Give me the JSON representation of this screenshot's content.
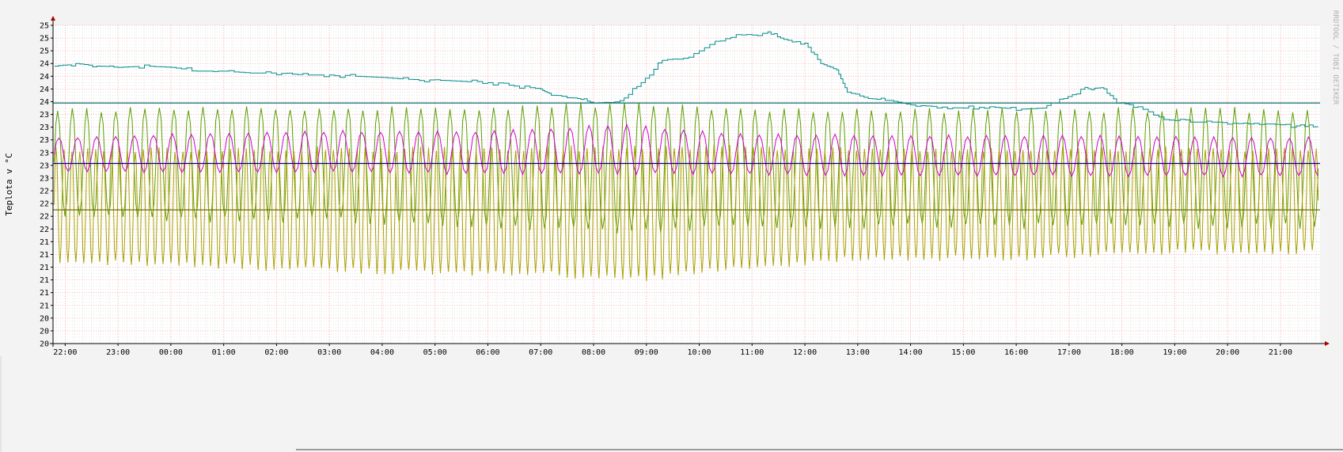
{
  "chart_data": {
    "type": "line",
    "ylabel": "Teplota v °C",
    "watermark": "RRDTOOL / TOBI OETIKER",
    "y_tick_labels": [
      "25",
      "25",
      "25",
      "24",
      "24",
      "24",
      "24",
      "23",
      "23",
      "23",
      "23",
      "23",
      "23",
      "22",
      "22",
      "22",
      "22",
      "21",
      "21",
      "21",
      "21",
      "21",
      "21",
      "20",
      "20",
      "20"
    ],
    "ylim": [
      20.0,
      25.0
    ],
    "x_tick_labels": [
      "22:00",
      "23:00",
      "00:00",
      "01:00",
      "02:00",
      "03:00",
      "04:00",
      "05:00",
      "06:00",
      "07:00",
      "08:00",
      "09:00",
      "10:00",
      "11:00",
      "12:00",
      "13:00",
      "14:00",
      "15:00",
      "16:00",
      "17:00",
      "18:00",
      "19:00",
      "20:00",
      "21:00"
    ],
    "xlim_hours": [
      21.77,
      45.75
    ],
    "grid": true,
    "colors": {
      "background": "#ffffff",
      "major_grid": "#ff9d9d",
      "minor_grid": "#d9d9d9",
      "axis": "#000000",
      "arrow": "#aa0000"
    },
    "series": [
      {
        "color": "#008c8c",
        "kind": "steps",
        "points": [
          [
            21.8,
            24.36
          ],
          [
            22.2,
            24.4
          ],
          [
            22.6,
            24.36
          ],
          [
            23.0,
            24.34
          ],
          [
            23.5,
            24.36
          ],
          [
            24.0,
            24.34
          ],
          [
            24.5,
            24.28
          ],
          [
            25.0,
            24.28
          ],
          [
            25.5,
            24.25
          ],
          [
            26.0,
            24.25
          ],
          [
            26.5,
            24.22
          ],
          [
            27.0,
            24.22
          ],
          [
            27.5,
            24.2
          ],
          [
            28.0,
            24.18
          ],
          [
            28.5,
            24.15
          ],
          [
            29.0,
            24.14
          ],
          [
            29.5,
            24.12
          ],
          [
            30.0,
            24.1
          ],
          [
            30.5,
            24.05
          ],
          [
            31.0,
            24.0
          ],
          [
            31.2,
            23.9
          ],
          [
            31.7,
            23.85
          ],
          [
            32.0,
            23.78
          ],
          [
            32.5,
            23.8
          ],
          [
            32.9,
            24.1
          ],
          [
            33.3,
            24.45
          ],
          [
            33.8,
            24.5
          ],
          [
            34.3,
            24.75
          ],
          [
            34.8,
            24.85
          ],
          [
            35.3,
            24.88
          ],
          [
            35.6,
            24.78
          ],
          [
            36.0,
            24.72
          ],
          [
            36.3,
            24.4
          ],
          [
            36.6,
            24.3
          ],
          [
            36.8,
            23.95
          ],
          [
            37.2,
            23.85
          ],
          [
            37.6,
            23.82
          ],
          [
            38.0,
            23.75
          ],
          [
            38.5,
            23.72
          ],
          [
            39.0,
            23.7
          ],
          [
            39.5,
            23.72
          ],
          [
            40.0,
            23.68
          ],
          [
            40.5,
            23.7
          ],
          [
            40.9,
            23.85
          ],
          [
            41.3,
            24.0
          ],
          [
            41.6,
            24.02
          ],
          [
            41.9,
            23.8
          ],
          [
            42.3,
            23.72
          ],
          [
            42.8,
            23.52
          ],
          [
            43.3,
            23.48
          ],
          [
            43.8,
            23.48
          ],
          [
            44.3,
            23.45
          ],
          [
            44.8,
            23.45
          ],
          [
            45.3,
            23.42
          ],
          [
            45.7,
            23.4
          ]
        ]
      },
      {
        "color": "#5a9e00",
        "kind": "oscillation",
        "period_min": 16.5,
        "bands": [
          [
            21.8,
            22.0,
            23.7
          ],
          [
            24.0,
            21.9,
            23.75
          ],
          [
            27.0,
            21.9,
            23.75
          ],
          [
            30.0,
            21.8,
            23.75
          ],
          [
            32.5,
            21.7,
            23.82
          ],
          [
            35.0,
            21.8,
            23.72
          ],
          [
            38.0,
            21.8,
            23.72
          ],
          [
            41.0,
            21.8,
            23.72
          ],
          [
            44.0,
            21.8,
            23.72
          ],
          [
            45.7,
            21.8,
            23.7
          ]
        ]
      },
      {
        "color": "#a9a000",
        "kind": "oscillation",
        "period_min": 9.0,
        "bands": [
          [
            21.8,
            21.25,
            23.1
          ],
          [
            24.0,
            21.2,
            23.1
          ],
          [
            27.0,
            21.1,
            23.1
          ],
          [
            31.0,
            21.05,
            23.1
          ],
          [
            32.7,
            20.95,
            23.15
          ],
          [
            34.5,
            21.1,
            23.15
          ],
          [
            37.0,
            21.3,
            23.1
          ],
          [
            40.0,
            21.3,
            23.1
          ],
          [
            43.0,
            21.4,
            23.1
          ],
          [
            45.7,
            21.4,
            23.1
          ]
        ]
      },
      {
        "color": "#d000d0",
        "kind": "oscillation",
        "period_min": 21.5,
        "bands": [
          [
            21.8,
            22.7,
            23.25
          ],
          [
            24.0,
            22.68,
            23.3
          ],
          [
            27.0,
            22.68,
            23.35
          ],
          [
            30.0,
            22.65,
            23.35
          ],
          [
            32.5,
            22.65,
            23.45
          ],
          [
            35.0,
            22.65,
            23.3
          ],
          [
            38.0,
            22.62,
            23.28
          ],
          [
            41.0,
            22.62,
            23.28
          ],
          [
            44.0,
            22.62,
            23.25
          ],
          [
            45.7,
            22.62,
            23.25
          ]
        ]
      }
    ],
    "hlines": [
      {
        "value": 23.78,
        "color": "#006e6e"
      },
      {
        "value": 22.83,
        "color": "#00008c"
      },
      {
        "value": 22.1,
        "color": "#6b6b00"
      }
    ]
  }
}
